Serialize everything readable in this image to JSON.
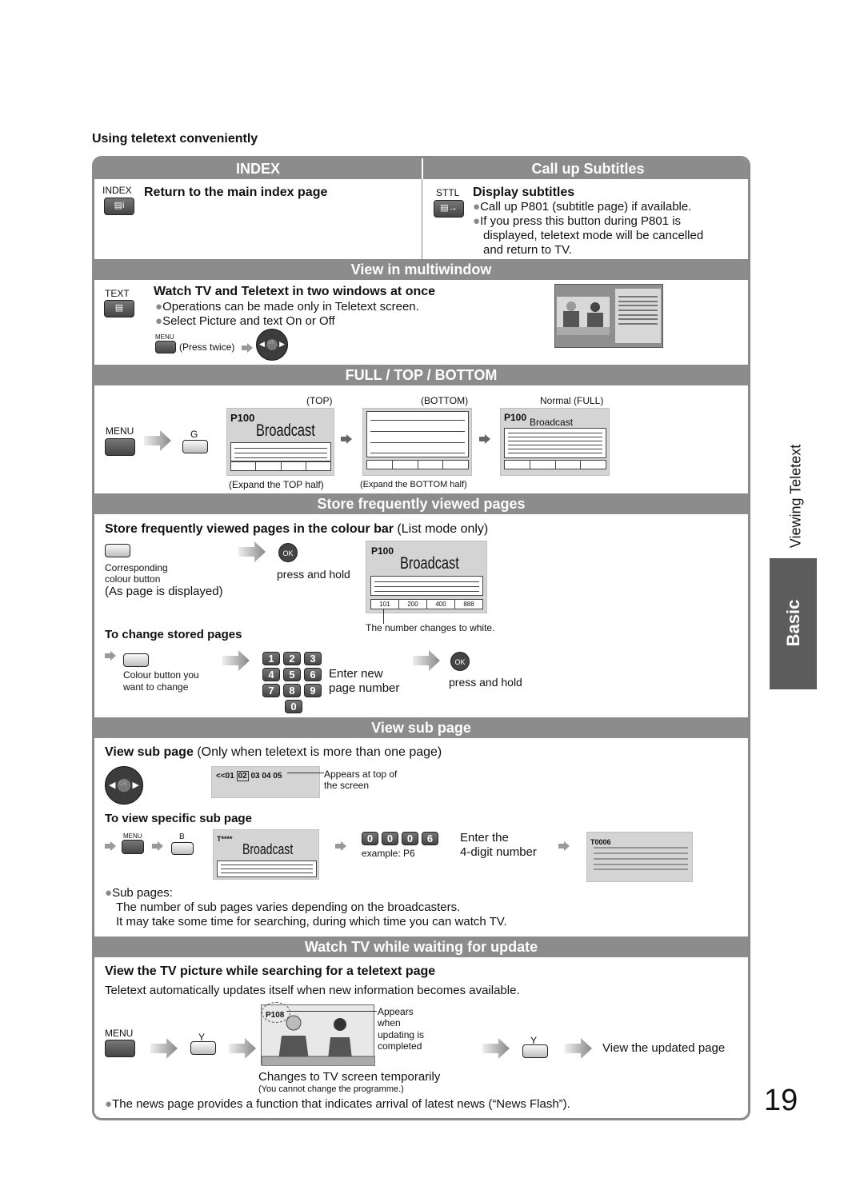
{
  "page_heading": "Using teletext conveniently",
  "side_tab": {
    "section": "Viewing Teletext",
    "category": "Basic"
  },
  "page_number": "19",
  "index": {
    "title": "INDEX",
    "button_label": "INDEX",
    "button_icon": "index-icon",
    "heading": "Return to the main index page"
  },
  "subtitles": {
    "title": "Call up Subtitles",
    "button_label": "STTL",
    "button_icon": "subtitle-icon",
    "heading": "Display subtitles",
    "bullets": [
      "Call up P801 (subtitle page) if available.",
      "If you press this button during P801 is",
      "displayed, teletext mode will be cancelled",
      "and return to TV."
    ]
  },
  "multiwindow": {
    "title": "View in multiwindow",
    "button_label": "TEXT",
    "heading": "Watch TV and Teletext in two windows at once",
    "bullets": [
      "Operations can be made only in Teletext screen.",
      "Select Picture and text On or Off"
    ],
    "menu_label": "MENU",
    "press_note": "(Press twice)",
    "ok_label": "OK"
  },
  "full_top_bottom": {
    "title": "FULL / TOP / BOTTOM",
    "menu_label": "MENU",
    "color_button": "G",
    "screens": [
      {
        "caption_top": "(TOP)",
        "page": "P100",
        "text": "Broadcast",
        "caption_bottom": "(Expand the TOP half)"
      },
      {
        "caption_top": "(BOTTOM)",
        "page": "",
        "text": "",
        "caption_bottom": "(Expand the BOTTOM half)"
      },
      {
        "caption_top": "Normal (FULL)",
        "page": "P100",
        "text": "Broadcast",
        "caption_bottom": ""
      }
    ]
  },
  "store_pages": {
    "title": "Store frequently viewed pages",
    "heading": "Store frequently viewed pages in the colour bar",
    "heading_note": "(List mode only)",
    "colour_button_caption_1": "Corresponding",
    "colour_button_caption_2": "colour button",
    "as_displayed": "(As page is displayed)",
    "ok_label": "OK",
    "press_hold": "press and hold",
    "screen_page": "P100",
    "screen_text": "Broadcast",
    "stored": [
      "101",
      "200",
      "400",
      "888"
    ],
    "number_note": "The number changes to white.",
    "change_heading": "To change stored pages",
    "change_caption_1": "Colour button you",
    "change_caption_2": "want to change",
    "keypad": [
      "1",
      "2",
      "3",
      "4",
      "5",
      "6",
      "7",
      "8",
      "9",
      "0"
    ],
    "enter_new_1": "Enter new",
    "enter_new_2": "page number",
    "press_hold_2": "press and hold"
  },
  "sub_page": {
    "title": "View sub page",
    "heading": "View sub page",
    "heading_note": "(Only when teletext is more than one page)",
    "ok_label": "OK",
    "subpage_prefix": "<<01",
    "subpage_current": "02",
    "subpage_rest": "03 04 05",
    "appears_1": "Appears at top of",
    "appears_2": "the screen",
    "specific_heading": "To view specific sub page",
    "menu_label": "MENU",
    "color_button": "B",
    "screen_page": "T****",
    "screen_text": "Broadcast",
    "digits": [
      "0",
      "0",
      "0",
      "6"
    ],
    "example": "example: P6",
    "enter_1": "Enter the",
    "enter_2": "4-digit number",
    "result_page": "T0006",
    "note_title": "Sub pages:",
    "note_lines": [
      "The number of sub pages varies depending on the broadcasters.",
      "It may take some time for searching, during which time you can watch TV."
    ]
  },
  "update": {
    "title": "Watch TV while waiting for update",
    "heading": "View the TV picture while searching for a teletext page",
    "description": "Teletext automatically updates itself when new information becomes available.",
    "menu_label": "MENU",
    "color_button": "Y",
    "screen_page": "P108",
    "appears": [
      "Appears",
      "when",
      "updating is",
      "completed"
    ],
    "caption": "Changes to TV screen temporarily",
    "caption_note": "(You cannot change the programme.)",
    "result": "View the updated page",
    "footnote": "The news page provides a function that indicates arrival of latest news (“News Flash”)."
  }
}
